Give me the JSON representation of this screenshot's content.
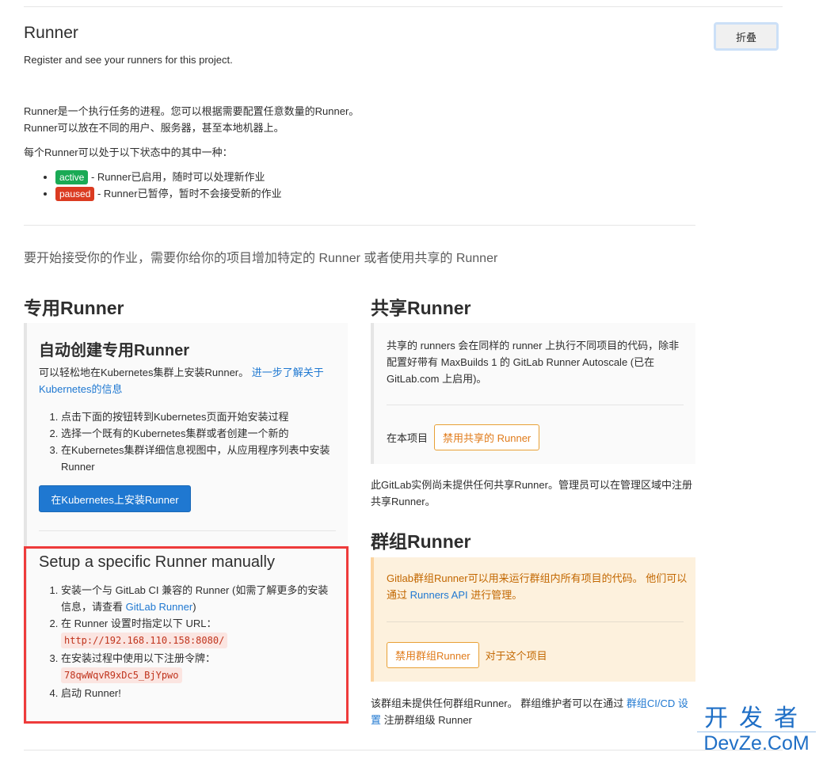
{
  "header": {
    "title": "Runner",
    "subtitle": "Register and see your runners for this project.",
    "collapse_label": "折叠"
  },
  "intro": {
    "line1": "Runner是一个执行任务的进程。您可以根据需要配置任意数量的Runner。",
    "line2": "Runner可以放在不同的用户、服务器，甚至本地机器上。",
    "states_intro": "每个Runner可以处于以下状态中的其中一种：",
    "states": [
      {
        "badge": "active",
        "text": " - Runner已启用，随时可以处理新作业",
        "color": "#1aaa55"
      },
      {
        "badge": "paused",
        "text": " - Runner已暂停，暂时不会接受新的作业",
        "color": "#db3b21"
      }
    ]
  },
  "lead": "要开始接受你的作业，需要你给你的项目增加特定的 Runner 或者使用共享的 Runner",
  "specific": {
    "title": "专用Runner",
    "auto": {
      "title": "自动创建专用Runner",
      "desc": "可以轻松地在Kubernetes集群上安装Runner。 ",
      "link": "进一步了解关于Kubernetes的信息",
      "steps": [
        "点击下面的按钮转到Kubernetes页面开始安装过程",
        "选择一个既有的Kubernetes集群或者创建一个新的",
        "在Kubernetes集群详细信息视图中，从应用程序列表中安装Runner"
      ],
      "button": "在Kubernetes上安装Runner"
    },
    "manual": {
      "title": "Setup a specific Runner manually",
      "step1_prefix": "安装一个与 GitLab CI 兼容的 Runner (如需了解更多的安装信息，请查看 ",
      "step1_link": "GitLab Runner",
      "step1_suffix": ")",
      "step2": "在 Runner 设置时指定以下 URL：",
      "url": "http://192.168.110.158:8080/",
      "step3": "在安装过程中使用以下注册令牌：",
      "token": "78qwWqvR9xDc5_BjYpwo",
      "step4": "启动 Runner!"
    }
  },
  "shared": {
    "title": "共享Runner",
    "desc": "共享的 runners 会在同样的 runner 上执行不同项目的代码，除非配置好带有 MaxBuilds 1 的 GitLab Runner Autoscale (已在 GitLab.com 上启用)。",
    "row_label": "在本项目",
    "disable_button": "禁用共享的 Runner",
    "note": "此GitLab实例尚未提供任何共享Runner。管理员可以在管理区域中注册共享Runner。"
  },
  "group": {
    "title": "群组Runner",
    "desc_prefix": "Gitlab群组Runner可以用来运行群组内所有项目的代码。 他们可以通过 ",
    "desc_link": "Runners API",
    "desc_suffix": " 进行管理。",
    "disable_button": "禁用群组Runner",
    "row_suffix": "对于这个项目",
    "note_prefix": "该群组未提供任何群组Runner。 群组维护者可以在通过 ",
    "note_link": "群组CI/CD 设置",
    "note_suffix": " 注册群组级 Runner"
  },
  "watermark": {
    "cn": "开发者",
    "en": "DevZe.CoM"
  }
}
